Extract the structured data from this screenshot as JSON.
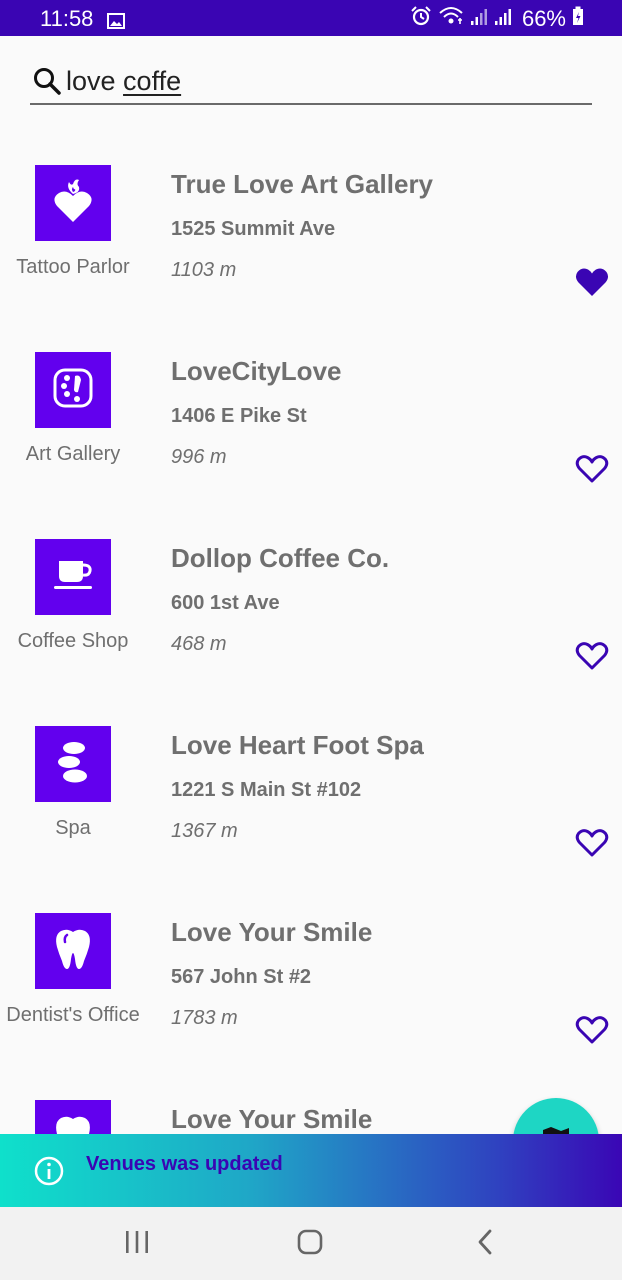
{
  "status_bar": {
    "time": "11:58",
    "battery": "66%",
    "icons": [
      "image-icon",
      "alarm-icon",
      "wifi-icon",
      "signal-icon",
      "signal-icon-2",
      "battery-charging-icon"
    ]
  },
  "search": {
    "value_plain": "love ",
    "value_underlined": "coffe"
  },
  "venues": [
    {
      "category": "Tattoo Parlor",
      "category_icon": "tattoo-icon",
      "name": "True Love Art Gallery",
      "address": "1525 Summit Ave",
      "distance": "1103 m",
      "favorite": true
    },
    {
      "category": "Art Gallery",
      "category_icon": "art-gallery-icon",
      "name": "LoveCityLove",
      "address": "1406 E Pike St",
      "distance": "996 m",
      "favorite": false
    },
    {
      "category": "Coffee Shop",
      "category_icon": "coffee-cup-icon",
      "name": "Dollop Coffee Co.",
      "address": "600 1st Ave",
      "distance": "468 m",
      "favorite": false
    },
    {
      "category": "Spa",
      "category_icon": "spa-stones-icon",
      "name": "Love Heart Foot Spa",
      "address": "1221 S Main St #102",
      "distance": "1367 m",
      "favorite": false
    },
    {
      "category": "Dentist's Office",
      "category_icon": "tooth-icon",
      "name": "Love Your Smile",
      "address": "567 John St #2",
      "distance": "1783 m",
      "favorite": false
    },
    {
      "category": "",
      "category_icon": "tooth-icon",
      "name": "Love Your Smile",
      "address": "",
      "distance": "",
      "favorite": false
    }
  ],
  "snackbar": {
    "message": "Venues was updated"
  },
  "colors": {
    "accent": "#6200ee",
    "status_bar": "#3a05b3",
    "fab": "#1ed6c4",
    "heart": "#3a05b3"
  }
}
